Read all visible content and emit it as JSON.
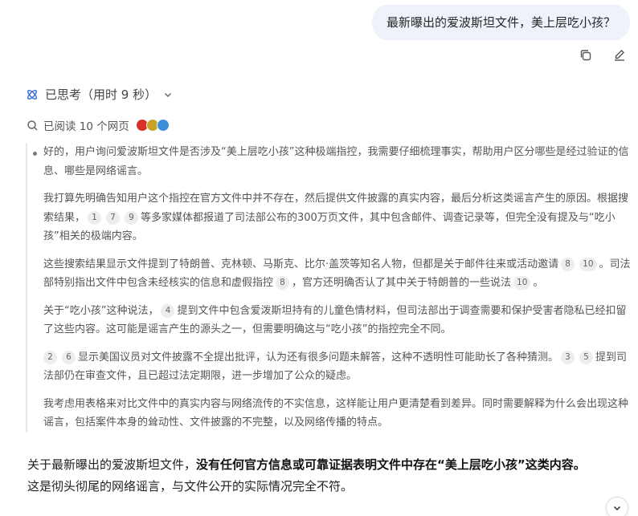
{
  "user_message": "最新曝出的爱波斯坦文件，美上层吃小孩？",
  "thinking": {
    "label": "已思考（用时 9 秒）",
    "read_pages": "已阅读 10 个网页"
  },
  "think_paragraphs": {
    "p1": "好的，用户询问爱波斯坦文件是否涉及“美上层吃小孩”这种极端指控，我需要仔细梳理事实，帮助用户区分哪些是经过验证的信息、哪些是网络谣言。",
    "p2a": "我打算先明确告知用户这个指控在官方文件中并不存在，然后提供文件披露的真实内容，最后分析这类谣言产生的原因。根据搜索结果，",
    "p2b": "等多家媒体都报道了司法部公布的300万页文件，其中包含邮件、调查记录等，但完全没有提及与“吃小孩”相关的极端内容。",
    "p3a": "这些搜索结果显示文件提到了特朗普、克林顿、马斯克、比尔·盖茨等知名人物，但都是关于邮件往来或活动邀请",
    "p3b": "。司法部特别指出文件中包含未经核实的信息和虚假指控",
    "p3c": "，官方还明确否认了其中关于特朗普的一些说法",
    "p3d": "。",
    "p4a": "关于“吃小孩”这种说法，",
    "p4b": "提到文件中包含爱泼斯坦持有的儿童色情材料，但司法部出于调查需要和保护受害者隐私已经扣留了这些内容。这可能是谣言产生的源头之一，但需要明确这与“吃小孩”的指控完全不同。",
    "p5a": "显示美国议员对文件披露不全提出批评，认为还有很多问题未解答，这种不透明性可能助长了各种猜测。",
    "p5b": "提到司法部仍在审查文件，且已超过法定期限，进一步增加了公众的疑虑。",
    "p6": "我考虑用表格来对比文件中的真实内容与网络流传的不实信息，这样能让用户更清楚看到差异。同时需要解释为什么会出现这种谣言，包括案件本身的耸动性、文件披露的不完整，以及网络传播的特点。"
  },
  "citations": {
    "c1": "1",
    "c7": "7",
    "c9": "9",
    "c8a": "8",
    "c10a": "10",
    "c8b": "8",
    "c10b": "10",
    "c4": "4",
    "c2": "2",
    "c6": "6",
    "c3": "3",
    "c5": "5"
  },
  "answer": {
    "lead": "关于最新曝出的爱波斯坦文件，",
    "bold": "没有任何官方信息或可靠证据表明文件中存在“美上层吃小孩”这类内容。",
    "tail": "这是彻头彻尾的网络谣言，与文件公开的实际情况完全不符。"
  },
  "colors": {
    "bubble_bg": "#eef3fb",
    "accent_blue": "#3b6fd4",
    "citation_bg": "#ededed"
  },
  "icons": [
    "copy-icon",
    "edit-icon",
    "thinking-icon",
    "chevron-down-icon",
    "search-icon",
    "site-icon",
    "arrow-down-icon"
  ]
}
